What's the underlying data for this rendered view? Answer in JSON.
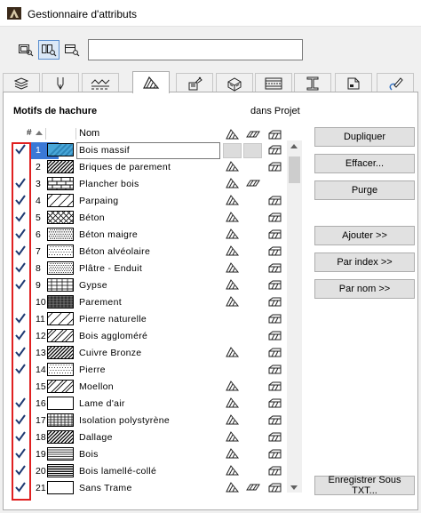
{
  "window": {
    "title": "Gestionnaire d'attributs"
  },
  "toolbar": {
    "view_buttons": [
      "list-view-icon",
      "detail-view-icon",
      "preview-view-icon"
    ],
    "search_value": ""
  },
  "tabs": [
    "layers-icon",
    "pen-icon",
    "line-types-icon",
    "fill-patterns-icon",
    "surfaces-icon",
    "building-materials-icon",
    "composites-icon",
    "profiles-icon",
    "zones-icon",
    "markup-icon"
  ],
  "section": {
    "title": "Motifs de hachure",
    "right_label": "dans Projet"
  },
  "list": {
    "header_hash": "#",
    "header_name": "Nom",
    "rows": [
      {
        "num": "1",
        "name": "Bois massif",
        "checked": true,
        "pattern": "wood-solid",
        "icons": [
          false,
          false,
          true
        ],
        "selected": true
      },
      {
        "num": "2",
        "name": "Briques de parement",
        "checked": false,
        "pattern": "diag-dense",
        "icons": [
          true,
          false,
          true
        ]
      },
      {
        "num": "3",
        "name": "Plancher bois",
        "checked": true,
        "pattern": "brick",
        "icons": [
          true,
          true,
          false
        ]
      },
      {
        "num": "4",
        "name": "Parpaing",
        "checked": true,
        "pattern": "diag-sparse",
        "icons": [
          true,
          false,
          true
        ]
      },
      {
        "num": "5",
        "name": "Béton",
        "checked": true,
        "pattern": "cross",
        "icons": [
          true,
          false,
          true
        ]
      },
      {
        "num": "6",
        "name": "Béton maigre",
        "checked": true,
        "pattern": "dots",
        "icons": [
          true,
          false,
          true
        ]
      },
      {
        "num": "7",
        "name": "Béton alvéolaire",
        "checked": true,
        "pattern": "dots-light",
        "icons": [
          true,
          false,
          true
        ]
      },
      {
        "num": "8",
        "name": "Plâtre - Enduit",
        "checked": true,
        "pattern": "fine-dots",
        "icons": [
          true,
          false,
          true
        ]
      },
      {
        "num": "9",
        "name": "Gypse",
        "checked": true,
        "pattern": "hatch-grid",
        "icons": [
          true,
          false,
          true
        ]
      },
      {
        "num": "10",
        "name": "Parement",
        "checked": false,
        "pattern": "dense-cross",
        "icons": [
          true,
          false,
          true
        ]
      },
      {
        "num": "11",
        "name": "Pierre naturelle",
        "checked": true,
        "pattern": "diag-sparse",
        "icons": [
          false,
          false,
          true
        ]
      },
      {
        "num": "12",
        "name": "Bois aggloméré",
        "checked": true,
        "pattern": "diag-mixed",
        "icons": [
          false,
          false,
          true
        ]
      },
      {
        "num": "13",
        "name": "Cuivre Bronze",
        "checked": true,
        "pattern": "diag-dense",
        "icons": [
          true,
          false,
          true
        ]
      },
      {
        "num": "14",
        "name": "Pierre",
        "checked": true,
        "pattern": "dots-light",
        "icons": [
          false,
          false,
          true
        ]
      },
      {
        "num": "15",
        "name": "Moellon",
        "checked": false,
        "pattern": "diag-mixed",
        "icons": [
          true,
          false,
          true
        ]
      },
      {
        "num": "16",
        "name": "Lame d'air",
        "checked": true,
        "pattern": "empty",
        "icons": [
          true,
          false,
          true
        ]
      },
      {
        "num": "17",
        "name": "Isolation polystyrène",
        "checked": true,
        "pattern": "grid",
        "icons": [
          true,
          false,
          true
        ]
      },
      {
        "num": "18",
        "name": "Dallage",
        "checked": true,
        "pattern": "diag-dense",
        "icons": [
          true,
          false,
          true
        ]
      },
      {
        "num": "19",
        "name": "Bois",
        "checked": true,
        "pattern": "horiz",
        "icons": [
          true,
          false,
          true
        ]
      },
      {
        "num": "20",
        "name": "Bois lamellé-collé",
        "checked": true,
        "pattern": "horiz-dense",
        "icons": [
          true,
          false,
          true
        ]
      },
      {
        "num": "21",
        "name": "Sans Trame",
        "checked": true,
        "pattern": "empty",
        "icons": [
          true,
          true,
          true
        ]
      }
    ]
  },
  "buttons": {
    "dupliquer": "Dupliquer",
    "effacer": "Effacer...",
    "purge": "Purge",
    "ajouter": "Ajouter >>",
    "par_index": "Par index >>",
    "par_nom": "Par nom >>",
    "enregistrer": "Enregistrer Sous TXT..."
  },
  "colors": {
    "accent": "#3a78d6",
    "highlight_frame": "#e02020",
    "check": "#1f3a73"
  }
}
